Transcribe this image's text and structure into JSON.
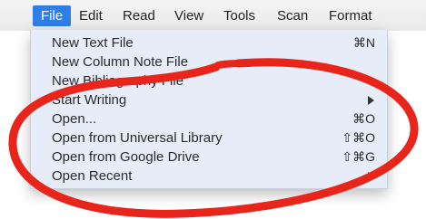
{
  "menubar": {
    "items": [
      {
        "label": "File",
        "active": true
      },
      {
        "label": "Edit"
      },
      {
        "label": "Read"
      },
      {
        "label": "View"
      },
      {
        "label": "Tools"
      },
      {
        "label": "Scan"
      },
      {
        "label": "Format"
      }
    ]
  },
  "file_menu": {
    "items": [
      {
        "label": "New Text File",
        "shortcut": "⌘N"
      },
      {
        "label": "New Column Note File",
        "shortcut": ""
      },
      {
        "label": "New Bibliography File",
        "shortcut": ""
      },
      {
        "label": "Start Writing",
        "submenu": true
      },
      {
        "label": "Open...",
        "shortcut": "⌘O"
      },
      {
        "label": "Open from Universal Library",
        "shortcut": "⇧⌘O"
      },
      {
        "label": "Open from Google Drive",
        "shortcut": "⇧⌘G"
      },
      {
        "label": "Open Recent",
        "submenu": true
      }
    ]
  },
  "colors": {
    "menu_highlight": "#2f7de6",
    "dropdown_bg": "#e6edf8",
    "annotation": "#e8251a"
  }
}
